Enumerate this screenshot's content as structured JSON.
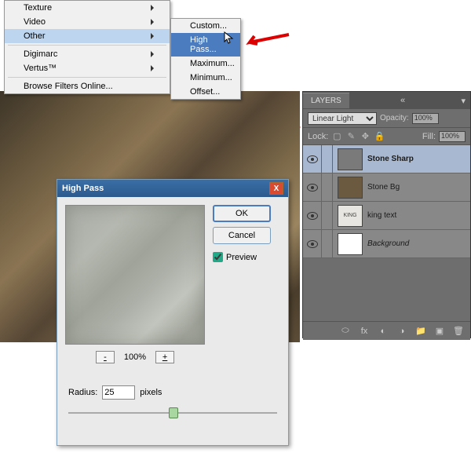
{
  "menu": {
    "items": [
      "Texture",
      "Video",
      "Other"
    ],
    "items2": [
      "Digimarc",
      "Vertus™"
    ],
    "browse": "Browse Filters Online..."
  },
  "submenu": {
    "items": [
      "Custom...",
      "High Pass...",
      "Maximum...",
      "Minimum...",
      "Offset..."
    ]
  },
  "dialog": {
    "title": "High Pass",
    "ok": "OK",
    "cancel": "Cancel",
    "preview": "Preview",
    "zoom": "100%",
    "minus": "-",
    "plus": "+",
    "radius_label": "Radius:",
    "radius_value": "25",
    "pixels": "pixels"
  },
  "layers": {
    "tab": "LAYERS",
    "blend": "Linear Light",
    "opacity_label": "Opacity:",
    "opacity_value": "100%",
    "lock_label": "Lock:",
    "fill_label": "Fill:",
    "fill_value": "100%",
    "rows": [
      {
        "name": "Stone Sharp",
        "sel": true,
        "thumb": "#7a7a7a"
      },
      {
        "name": "Stone Bg",
        "sel": false,
        "thumb": "#6b5a3f"
      },
      {
        "name": "king text",
        "sel": false,
        "thumb": "#e8e6e0"
      },
      {
        "name": "Background",
        "sel": false,
        "thumb": "#ffffff",
        "italic": true
      }
    ]
  }
}
